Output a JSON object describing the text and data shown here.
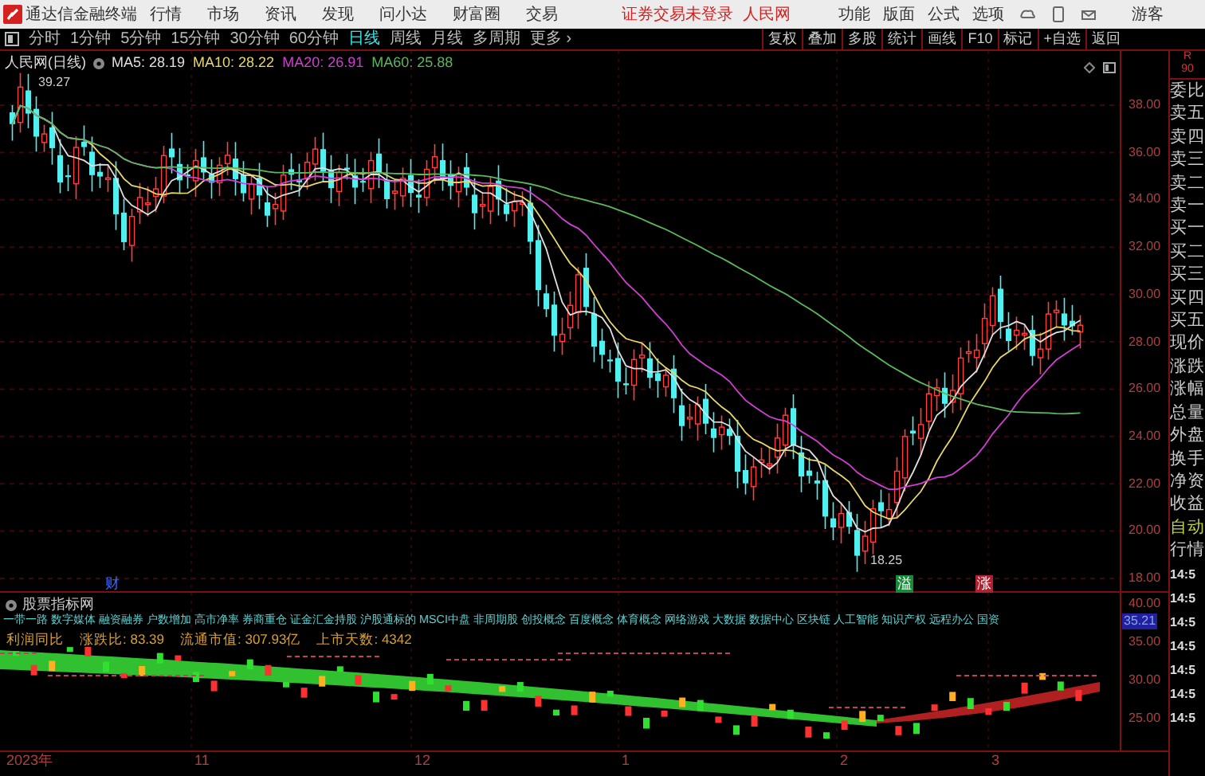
{
  "window": {
    "app_title": "通达信金融终端",
    "menu": [
      "行情",
      "市场",
      "资讯",
      "发现",
      "问小达",
      "财富圈",
      "交易"
    ],
    "login_status": "证券交易未登录",
    "stock_name": "人民网",
    "tools": [
      "功能",
      "版面",
      "公式",
      "选项"
    ],
    "user": "游客"
  },
  "period_tabs": [
    {
      "label": "分时",
      "selected": false
    },
    {
      "label": "1分钟",
      "selected": false
    },
    {
      "label": "5分钟",
      "selected": false
    },
    {
      "label": "15分钟",
      "selected": false
    },
    {
      "label": "30分钟",
      "selected": false
    },
    {
      "label": "60分钟",
      "selected": false
    },
    {
      "label": "日线",
      "selected": true
    },
    {
      "label": "周线",
      "selected": false
    },
    {
      "label": "月线",
      "selected": false
    },
    {
      "label": "多周期",
      "selected": false
    },
    {
      "label": "更多 ›",
      "selected": false
    }
  ],
  "toolbar": [
    "复权",
    "叠加",
    "多股",
    "统计",
    "画线",
    "F10",
    "标记",
    "+自选",
    "返回"
  ],
  "price_chart": {
    "title": "人民网(日线)",
    "moving_averages": [
      {
        "label": "MA5: 28.19",
        "color": "#e0e0e0"
      },
      {
        "label": "MA10: 28.22",
        "color": "#e8d86c"
      },
      {
        "label": "MA20: 26.91",
        "color": "#d040d0"
      },
      {
        "label": "MA60: 25.88",
        "color": "#5cb85c"
      }
    ],
    "high_label": "39.27",
    "low_label": "18.25",
    "y_axis": [
      "38.00",
      "36.00",
      "34.00",
      "32.00",
      "30.00",
      "28.00",
      "26.00",
      "24.00",
      "22.00",
      "20.00",
      "18.00"
    ],
    "markers": [
      {
        "text": "财",
        "kind": "text",
        "color": "#3a6cff"
      },
      {
        "text": "溢",
        "kind": "badge",
        "color": "#1a8a3a"
      },
      {
        "text": "涨",
        "kind": "badge",
        "color": "#b02030"
      }
    ]
  },
  "indicator": {
    "title": "股票指标网",
    "concepts": "一带一路 数字媒体 融资融券 户数增加 高市净率 券商重仓 证金汇金持股 沪股通标的 MSCI中盘 非周期股 创投概念 百度概念 体育概念 网络游戏 大数据 数据中心 区块链 人工智能 知识产权 远程办公 国资",
    "stats": [
      "利润同比",
      "涨跌比: 83.39",
      "流通市值: 307.93亿",
      "上市天数: 4342"
    ],
    "y_axis": [
      "40.00",
      "35.00",
      "30.00",
      "25.00"
    ],
    "current_value": "35.21"
  },
  "time_axis": [
    "2023年",
    "11",
    "12",
    "1",
    "2",
    "3"
  ],
  "side_panel": {
    "corner": [
      "R",
      "90"
    ],
    "labels": [
      {
        "text": "委比",
        "kind": "normal"
      },
      {
        "text": "卖五",
        "kind": "normal"
      },
      {
        "text": "卖四",
        "kind": "normal"
      },
      {
        "text": "卖三",
        "kind": "normal"
      },
      {
        "text": "卖二",
        "kind": "normal"
      },
      {
        "text": "卖一",
        "kind": "normal"
      },
      {
        "text": "买一",
        "kind": "normal"
      },
      {
        "text": "买二",
        "kind": "normal"
      },
      {
        "text": "买三",
        "kind": "normal"
      },
      {
        "text": "买四",
        "kind": "normal"
      },
      {
        "text": "买五",
        "kind": "normal"
      },
      {
        "text": "现价",
        "kind": "normal"
      },
      {
        "text": "涨跌",
        "kind": "normal"
      },
      {
        "text": "涨幅",
        "kind": "normal"
      },
      {
        "text": "总量",
        "kind": "normal"
      },
      {
        "text": "外盘",
        "kind": "normal"
      },
      {
        "text": "换手",
        "kind": "normal"
      },
      {
        "text": "净资",
        "kind": "normal"
      },
      {
        "text": "收益",
        "kind": "normal"
      },
      {
        "text": "自动",
        "kind": "accent"
      },
      {
        "text": "行情",
        "kind": "normal"
      }
    ],
    "times": [
      "14:5",
      "14:5",
      "14:5",
      "14:5",
      "14:5",
      "14:5",
      "14:5"
    ]
  }
}
